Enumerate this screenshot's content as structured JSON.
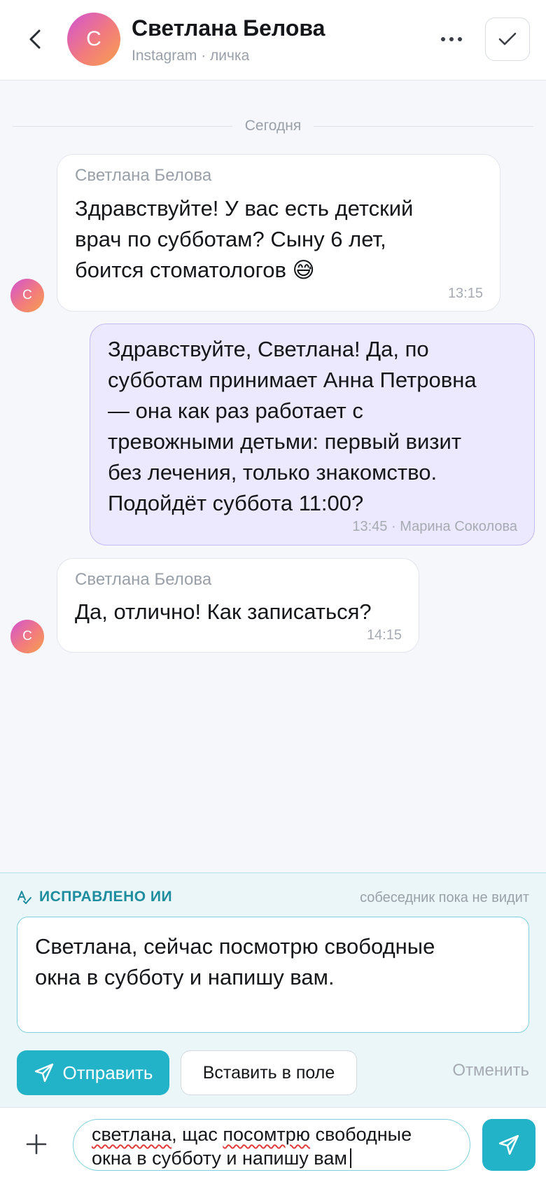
{
  "header": {
    "avatar_letter": "С",
    "contact_name": "Светлана Белова",
    "contact_subtitle": "Instagram · личка",
    "icons": [
      "chevron-left-icon",
      "more-horizontal-icon",
      "check-icon"
    ]
  },
  "chat": {
    "date_separator": "Сегодня",
    "messages": [
      {
        "direction": "incoming",
        "author": "Светлана Белова",
        "avatar_letter": "С",
        "lines": [
          "Здравствуйте! У вас есть детский",
          "врач по субботам? Сыну 6 лет,",
          "боится стоматологов 😅"
        ],
        "time": "13:15"
      },
      {
        "direction": "outgoing",
        "lines": [
          "Здравствуйте, Светлана! Да, по",
          "субботам принимает Анна Петровна",
          "— она как раз работает с",
          "тревожными детьми: первый визит",
          "без лечения, только знакомство.",
          "Подойдёт суббота 11:00?"
        ],
        "meta": "13:45 · Марина Соколова"
      },
      {
        "direction": "incoming",
        "author": "Светлана Белова",
        "avatar_letter": "С",
        "lines": [
          "Да, отлично! Как записаться?"
        ],
        "time": "14:15"
      }
    ]
  },
  "ai_panel": {
    "label": "ИСПРАВЛЕНО ИИ",
    "note": "собеседник пока не видит",
    "corrected_lines": [
      "Светлана, сейчас посмотрю свободные",
      "окна в субботу и напишу вам."
    ],
    "send_label": "Отправить",
    "insert_label": "Вставить в поле",
    "cancel_label": "Отменить"
  },
  "composer": {
    "draft_parts": {
      "typo1": "светлана",
      "mid1": ", щас ",
      "typo2": "посомтрю",
      "end1": " свободные",
      "line2": "окна в субботу и напишу вам"
    }
  },
  "colors": {
    "accent": "#23b3c9",
    "outgoing_bubble": "#ece8fd",
    "ai_label": "#1c8c9e",
    "background": "#f5f7fb"
  }
}
